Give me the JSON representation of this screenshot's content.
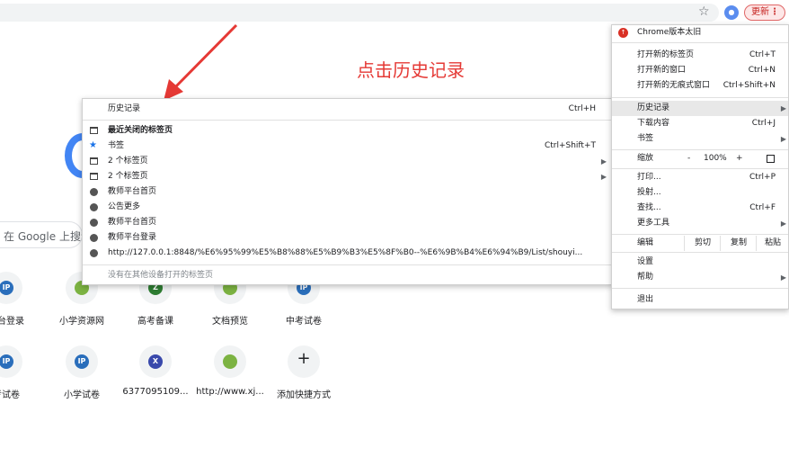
{
  "toolbar": {
    "update_label": "更新"
  },
  "ntp": {
    "search_placeholder": "在 Google 上搜索",
    "tiles_row1": [
      {
        "label": "平台登录",
        "letter": "IP",
        "color": "#2a6ebb"
      },
      {
        "label": "小学资源网",
        "letter": "",
        "color": "#7cb342"
      },
      {
        "label": "高考备课",
        "letter": "Z",
        "color": "#2e7d32"
      },
      {
        "label": "文档预览",
        "letter": "",
        "color": "#7cb342"
      },
      {
        "label": "中考试卷",
        "letter": "IP",
        "color": "#2a6ebb"
      }
    ],
    "tiles_row2": [
      {
        "label": "考试卷",
        "letter": "IP",
        "color": "#2a6ebb"
      },
      {
        "label": "小学试卷",
        "letter": "IP",
        "color": "#2a6ebb"
      },
      {
        "label": "6377095109...",
        "letter": "X",
        "color": "#3949ab"
      },
      {
        "label": "http://www.xj...",
        "letter": "",
        "color": "#7cb342"
      },
      {
        "label": "添加快捷方式",
        "letter": "+",
        "color": ""
      }
    ]
  },
  "annotation": "点击历史记录",
  "history_menu": {
    "title": "历史记录",
    "title_shortcut": "Ctrl+H",
    "recently_closed": "最近关闭的标签页",
    "items": [
      {
        "label": "书签",
        "shortcut": "Ctrl+Shift+T",
        "icon": "star-icon"
      },
      {
        "label": "2 个标签页",
        "shortcut": "",
        "icon": "tab-icon",
        "submenu": true
      },
      {
        "label": "2 个标签页",
        "shortcut": "",
        "icon": "tab-icon",
        "submenu": true
      },
      {
        "label": "教师平台首页",
        "shortcut": "",
        "icon": "globe-icon"
      },
      {
        "label": "公告更多",
        "shortcut": "",
        "icon": "globe-icon"
      },
      {
        "label": "教师平台首页",
        "shortcut": "",
        "icon": "globe-icon"
      },
      {
        "label": "教师平台登录",
        "shortcut": "",
        "icon": "globe-icon"
      },
      {
        "label": "http://127.0.0.1:8848/%E6%95%99%E5%B8%88%E5%B9%B3%E5%8F%B0--%E6%9B%B4%E6%94%B9/List/shouyi...",
        "shortcut": "",
        "icon": "globe-icon"
      }
    ],
    "other_devices": "没有在其他设备打开的标签页"
  },
  "chrome_menu": {
    "update_notice": "Chrome版本太旧",
    "new_tab": "打开新的标签页",
    "new_tab_key": "Ctrl+T",
    "new_window": "打开新的窗口",
    "new_window_key": "Ctrl+N",
    "incognito": "打开新的无痕式窗口",
    "incognito_key": "Ctrl+Shift+N",
    "history": "历史记录",
    "downloads": "下载内容",
    "downloads_key": "Ctrl+J",
    "bookmarks": "书签",
    "zoom": "缩放",
    "zoom_minus": "-",
    "zoom_value": "100%",
    "zoom_plus": "+",
    "print": "打印...",
    "print_key": "Ctrl+P",
    "cast": "投射...",
    "find": "查找...",
    "find_key": "Ctrl+F",
    "more_tools": "更多工具",
    "edit": "编辑",
    "cut": "剪切",
    "copy": "复制",
    "paste": "粘贴",
    "settings": "设置",
    "help": "帮助",
    "exit": "退出"
  }
}
